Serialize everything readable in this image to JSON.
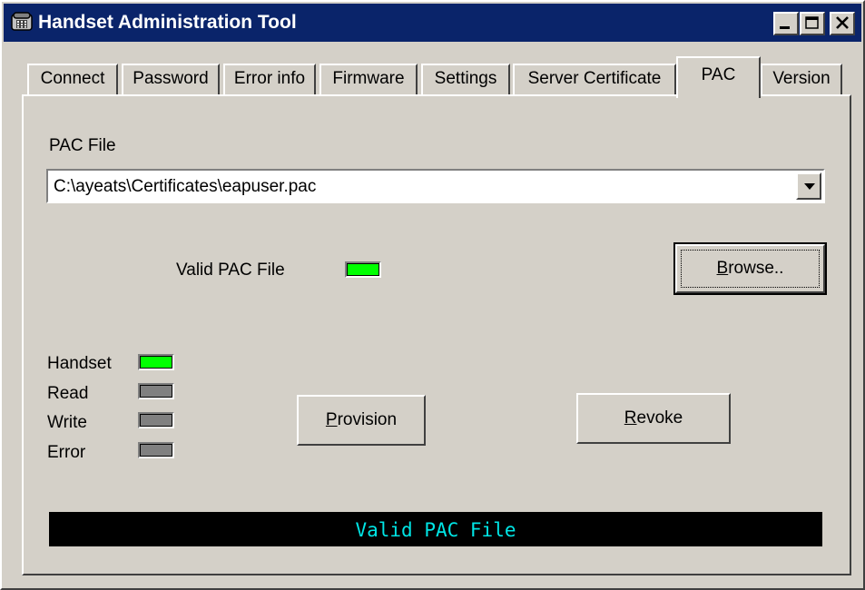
{
  "window": {
    "title": "Handset Administration Tool"
  },
  "tabs": [
    {
      "label": "Connect"
    },
    {
      "label": "Password"
    },
    {
      "label": "Error info"
    },
    {
      "label": "Firmware"
    },
    {
      "label": "Settings"
    },
    {
      "label": "Server Certificate"
    },
    {
      "label": "PAC",
      "selected": true
    },
    {
      "label": "Version"
    }
  ],
  "pac": {
    "file_label": "PAC File",
    "file_path": "C:\\ayeats\\Certificates\\eapuser.pac",
    "valid_label": "Valid PAC File",
    "valid_color": "#00ff00"
  },
  "buttons": {
    "browse": "Browse..",
    "provision": "Provision",
    "revoke": "Revoke"
  },
  "indicators": [
    {
      "label": "Handset",
      "color": "#00ff00"
    },
    {
      "label": "Read",
      "color": "#808080"
    },
    {
      "label": "Write",
      "color": "#808080"
    },
    {
      "label": "Error",
      "color": "#808080"
    }
  ],
  "status": {
    "text": "Valid PAC File",
    "color": "#00e5e5"
  }
}
